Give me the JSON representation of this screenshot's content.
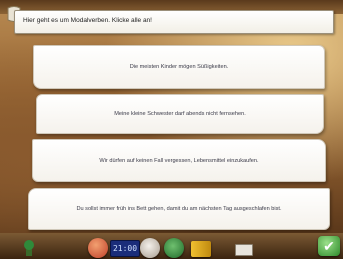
{
  "instruction": {
    "text": "Hier geht es um Modalverben. Klicke alle an!"
  },
  "sentences": [
    "Die meisten Kinder mögen Süßigkeiten.",
    "Meine kleine Schwester darf abends nicht fernsehen.",
    "Wir dürfen auf keinen Fall vergessen, Lebensmittel einzukaufen.",
    "Du sollst immer früh ins Bett gehen, damit du am nächsten Tag ausgeschlafen bist."
  ],
  "toolbar": {
    "clock_value": "21:00",
    "icons": [
      "home-icon",
      "clock-icon",
      "speaker-icon",
      "globe-icon",
      "book-icon",
      "card-icon",
      "check-icon"
    ]
  },
  "colors": {
    "wood_dark": "#4b2c14",
    "wood_light": "#b88a52",
    "card_bg": "#ffffff",
    "text": "#3a3a48",
    "check": "#2e8a2a"
  }
}
